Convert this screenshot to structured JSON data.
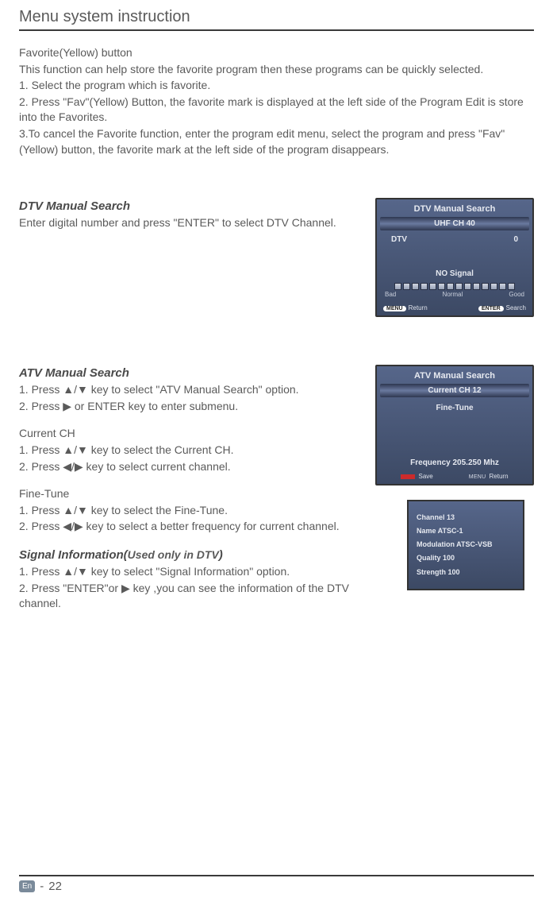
{
  "page_title": "Menu system instruction",
  "favorite": {
    "heading": "Favorite(Yellow) button",
    "intro": "This function can help store the favorite program then these programs can be quickly selected.",
    "step1": "1. Select the program which is favorite.",
    "step2": "2. Press \"Fav\"(Yellow) Button, the favorite mark is displayed at the left side of the Program Edit is store into the Favorites.",
    "step3": "3.To cancel the Favorite function, enter the program edit menu, select the program and press \"Fav\"(Yellow) button, the favorite mark at the left side of the program disappears."
  },
  "dtv": {
    "heading": "DTV Manual Search",
    "desc": "Enter digital number and press \"ENTER\" to select DTV Channel."
  },
  "atv": {
    "heading": "ATV Manual Search",
    "step1": "1. Press ▲/▼ key to select \"ATV Manual Search\" option.",
    "step2": "2. Press ▶ or ENTER key to enter submenu.",
    "current_head": "Current CH",
    "cstep1": "1. Press ▲/▼ key to select the Current CH.",
    "cstep2": "2. Press ◀/▶ key to select current channel.",
    "fine_head": "Fine-Tune",
    "fstep1": "1. Press ▲/▼ key to select the Fine-Tune.",
    "fstep2": "2. Press ◀/▶ key to select a better frequency for current channel."
  },
  "siginfo": {
    "heading_pre": "Signal Information(",
    "heading_mid": "Used only in DTV",
    "heading_post": ")",
    "step1": "1. Press ▲/▼ key to select \"Signal Information\" option.",
    "step2": "2. Press \"ENTER\"or ▶ key ,you can see the information of  the DTV channel."
  },
  "osd_dtv": {
    "title": "DTV Manual Search",
    "band": "UHF CH 40",
    "dtv_label": "DTV",
    "dtv_value": "0",
    "no_signal": "NO Signal",
    "bad": "Bad",
    "normal": "Normal",
    "good": "Good",
    "menu_key": "MENU",
    "return_label": "Return",
    "enter_key": "ENTER",
    "search_label": "Search"
  },
  "osd_atv": {
    "title": "ATV Manual Search",
    "band": "Current CH 12",
    "fine": "Fine-Tune",
    "freq": "Frequency 205.250 Mhz",
    "save": "Save",
    "menu_small": "MENU",
    "return": "Return"
  },
  "osd_info": {
    "l1": "Channel 13",
    "l2": "Name ATSC-1",
    "l3": "Modulation ATSC-VSB",
    "l4": "Quality 100",
    "l5": "Strength 100"
  },
  "footer": {
    "en": "En",
    "dash": "-",
    "page": "22"
  }
}
